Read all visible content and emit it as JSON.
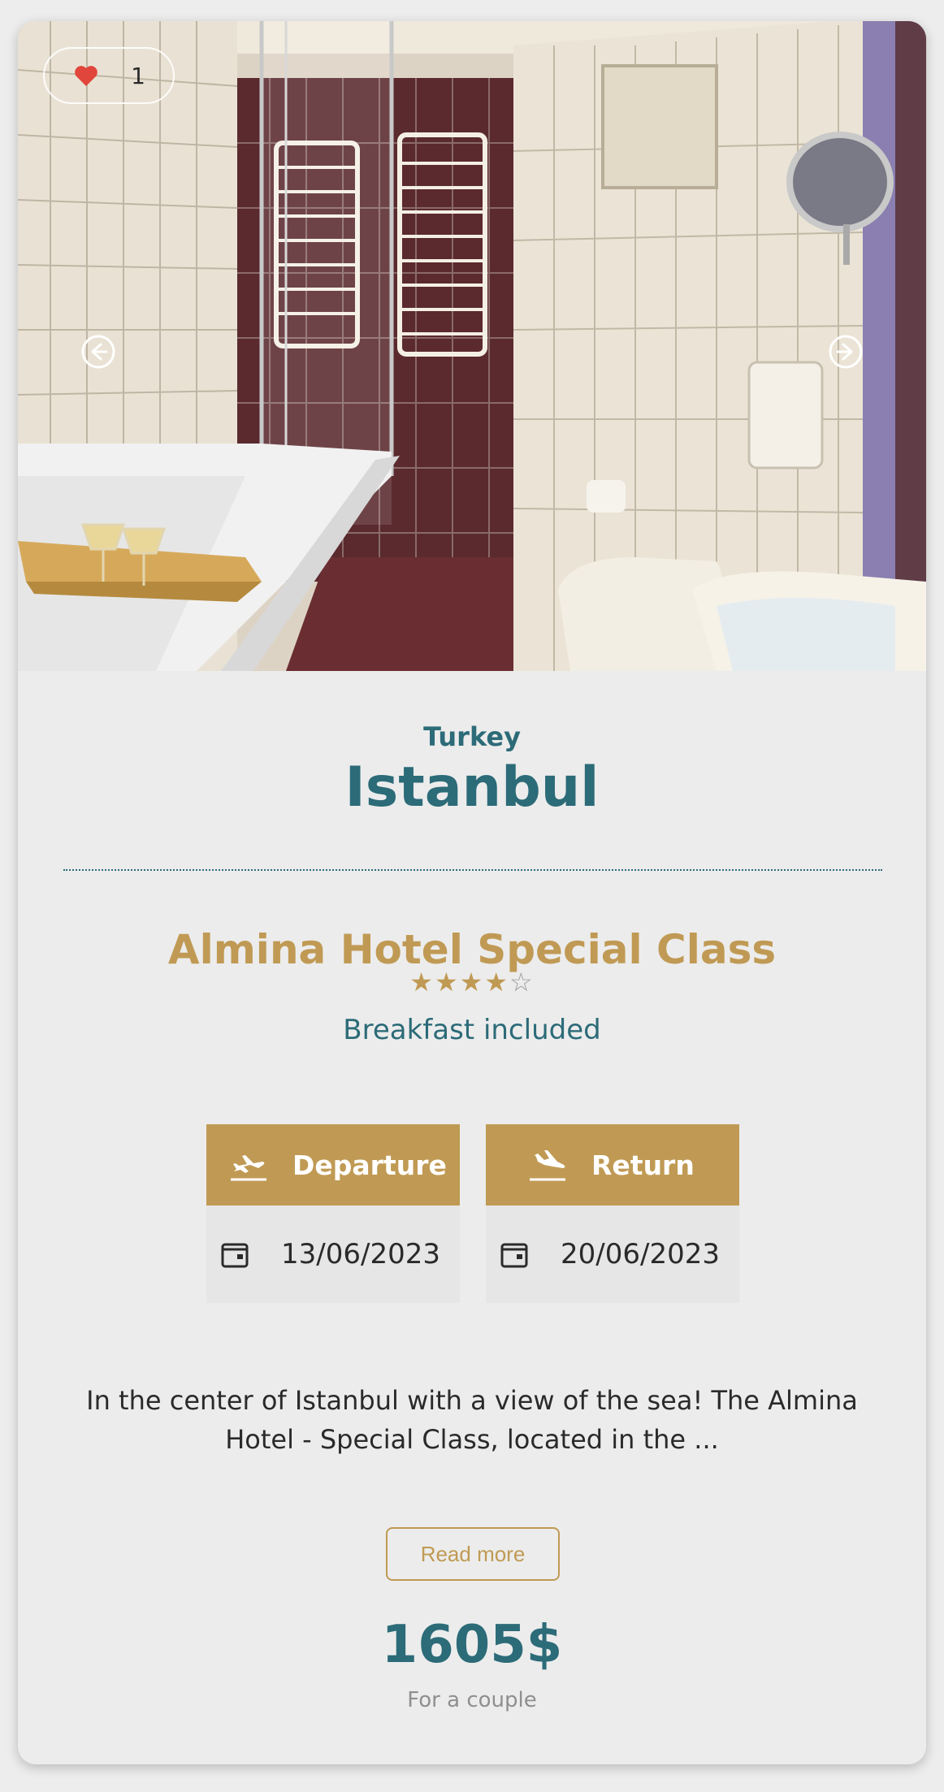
{
  "like": {
    "count": "1",
    "icon": "heart-icon"
  },
  "gallery": {
    "prev_icon": "arrow-left-circle-icon",
    "next_icon": "arrow-right-circle-icon"
  },
  "location": {
    "country": "Turkey",
    "city": "Istanbul"
  },
  "hotel": {
    "name": "Almina Hotel Special Class",
    "rating": 4,
    "max_rating": 5,
    "board": "Breakfast included"
  },
  "flights": {
    "departure": {
      "label": "Departure",
      "date": "13/06/2023",
      "icon": "plane-takeoff-icon"
    },
    "return": {
      "label": "Return",
      "date": "20/06/2023",
      "icon": "plane-landing-icon"
    }
  },
  "description": "In the center of Istanbul with a view of the sea! The Almina Hotel - Special Class, located in the ...",
  "read_more_label": "Read more",
  "price": {
    "amount": "1605$",
    "note": "For a couple"
  },
  "colors": {
    "teal": "#2c6b78",
    "gold": "#c09a54",
    "heart": "#e0463c",
    "card_bg": "#ececec"
  }
}
